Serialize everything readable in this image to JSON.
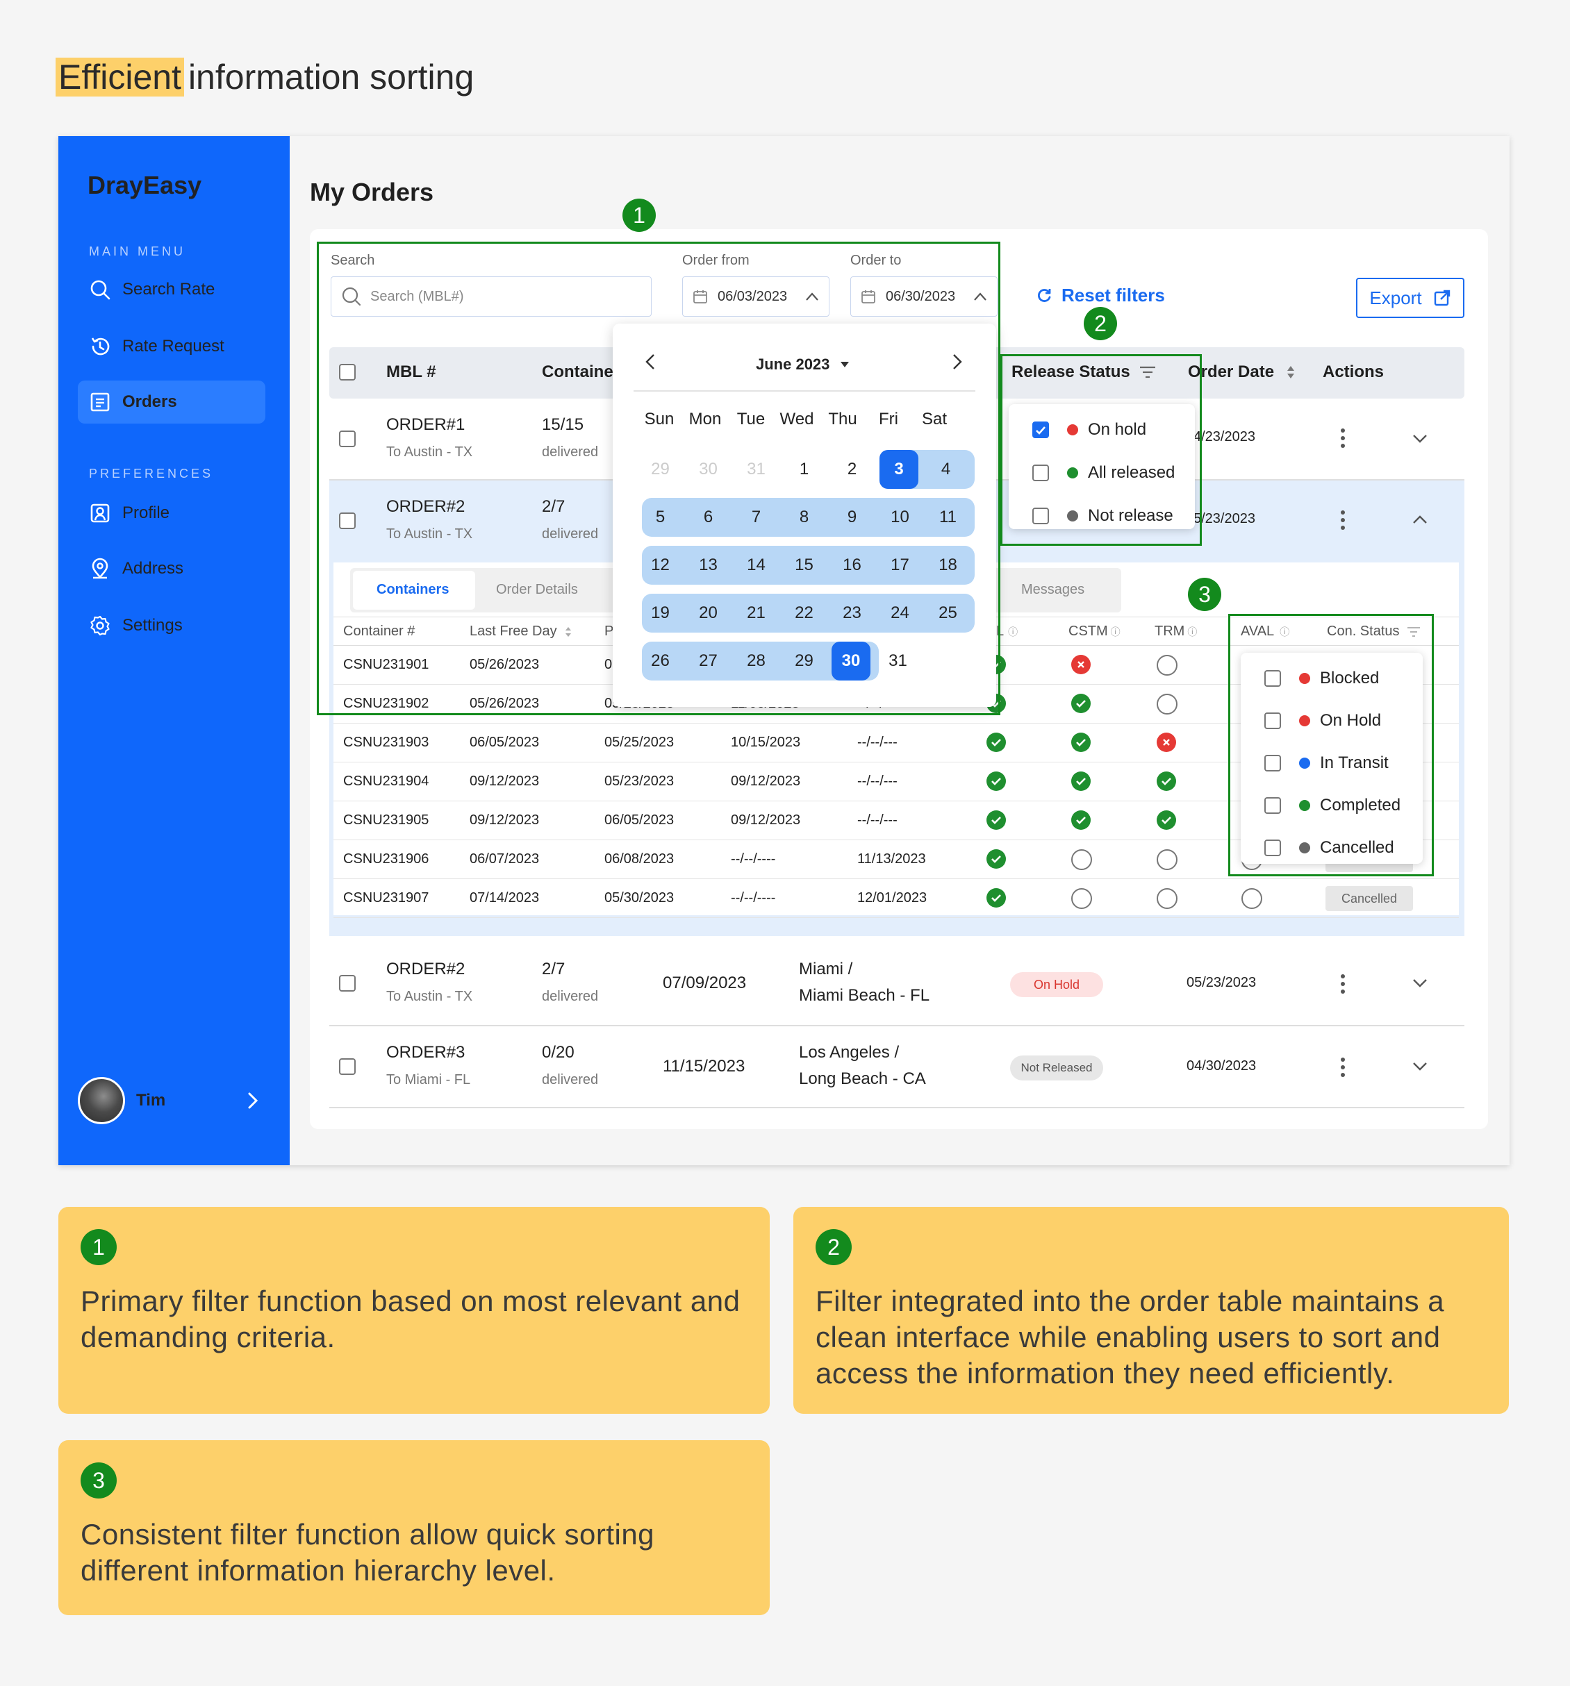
{
  "heading": {
    "highlight": "Efficient",
    "rest": "information sorting"
  },
  "sidebar": {
    "logo": "DrayEasy",
    "main_menu_label": "MAIN MENU",
    "preferences_label": "PREFERENCES",
    "items": [
      {
        "label": "Search Rate",
        "icon": "search-icon"
      },
      {
        "label": "Rate Request",
        "icon": "history-icon"
      },
      {
        "label": "Orders",
        "icon": "orders-icon",
        "active": true
      },
      {
        "label": "Profile",
        "icon": "profile-icon"
      },
      {
        "label": "Address",
        "icon": "location-icon"
      },
      {
        "label": "Settings",
        "icon": "gear-icon"
      }
    ],
    "user": {
      "name": "Tim"
    }
  },
  "page_title": "My Orders",
  "filters": {
    "search_label": "Search",
    "search_placeholder": "Search (MBL#)",
    "order_from_label": "Order from",
    "order_from_value": "06/03/2023",
    "order_to_label": "Order to",
    "order_to_value": "06/30/2023",
    "reset_label": "Reset filters",
    "export_label": "Export"
  },
  "table": {
    "headers": {
      "mbl": "MBL #",
      "container": "Containe",
      "release": "Release Status",
      "order_date": "Order Date",
      "actions": "Actions"
    },
    "rows": [
      {
        "order": "ORDER#1",
        "route": "To Austin - TX",
        "count": "15/15",
        "count_sub": "delivered",
        "order_date": "4/23/2023"
      },
      {
        "order": "ORDER#2",
        "route": "To Austin - TX",
        "count": "2/7",
        "count_sub": "delivered",
        "order_date": "5/23/2023"
      },
      {
        "order": "ORDER#2",
        "route": "To Austin - TX",
        "count": "2/7",
        "count_sub": "delivered",
        "eta": "07/09/2023",
        "dest1": "Miami /",
        "dest2": "Miami Beach - FL",
        "status": "On Hold",
        "order_date": "05/23/2023"
      },
      {
        "order": "ORDER#3",
        "route": "To Miami - FL",
        "count": "0/20",
        "count_sub": "delivered",
        "eta": "11/15/2023",
        "dest1": "Los Angeles /",
        "dest2": "Long Beach - CA",
        "status": "Not Released",
        "order_date": "04/30/2023"
      }
    ]
  },
  "subtabs": [
    "Containers",
    "Order Details",
    "Messages"
  ],
  "subtable": {
    "headers": {
      "container": "Container #",
      "lfd": "Last Free Day",
      "p": "P",
      "l": "L",
      "cstm": "CSTM",
      "trm": "TRM",
      "aval": "AVAL",
      "con_status": "Con. Status"
    },
    "rows": [
      {
        "c": "CSNU231901",
        "lfd": "05/26/2023",
        "d2": "0",
        "d3": "",
        "d4": "",
        "cstm": "bad",
        "trm": "empty",
        "aval": "empty"
      },
      {
        "c": "CSNU231902",
        "lfd": "05/26/2023",
        "d2": "05/23/2023",
        "d3": "11/08/2023",
        "d4": "--/--/----",
        "cstm": "ok",
        "trm": "empty",
        "aval": "empty"
      },
      {
        "c": "CSNU231903",
        "lfd": "06/05/2023",
        "d2": "05/25/2023",
        "d3": "10/15/2023",
        "d4": "--/--/---",
        "cstm": "ok",
        "trm": "bad",
        "aval": "empty"
      },
      {
        "c": "CSNU231904",
        "lfd": "09/12/2023",
        "d2": "05/23/2023",
        "d3": "09/12/2023",
        "d4": "--/--/---",
        "cstm": "ok",
        "trm": "ok",
        "aval": "empty"
      },
      {
        "c": "CSNU231905",
        "lfd": "09/12/2023",
        "d2": "06/05/2023",
        "d3": "09/12/2023",
        "d4": "--/--/---",
        "cstm": "ok",
        "trm": "ok",
        "aval": "empty"
      },
      {
        "c": "CSNU231906",
        "lfd": "06/07/2023",
        "d2": "06/08/2023",
        "d3": "--/--/----",
        "d4": "11/13/2023",
        "cstm": "empty",
        "trm": "empty",
        "aval": "empty",
        "status": "Cancelled"
      },
      {
        "c": "CSNU231907",
        "lfd": "07/14/2023",
        "d2": "05/30/2023",
        "d3": "--/--/----",
        "d4": "12/01/2023",
        "cstm": "empty",
        "trm": "empty",
        "aval": "empty",
        "status": "Cancelled"
      }
    ]
  },
  "calendar": {
    "month_label": "June 2023",
    "weekdays": [
      "Sun",
      "Mon",
      "Tue",
      "Wed",
      "Thu",
      "Fri",
      "Sat"
    ],
    "weeks": [
      [
        "29",
        "30",
        "31",
        "1",
        "2",
        "3",
        "4"
      ],
      [
        "5",
        "6",
        "7",
        "8",
        "9",
        "10",
        "11"
      ],
      [
        "12",
        "13",
        "14",
        "15",
        "16",
        "17",
        "18"
      ],
      [
        "19",
        "20",
        "21",
        "22",
        "23",
        "24",
        "25"
      ],
      [
        "26",
        "27",
        "28",
        "29",
        "30",
        "31"
      ]
    ],
    "range_start": "3",
    "range_end": "30"
  },
  "release_filter": [
    {
      "label": "On hold",
      "color": "#e53935",
      "checked": true
    },
    {
      "label": "All released",
      "color": "#1f8f2f",
      "checked": false
    },
    {
      "label": "Not release",
      "color": "#666666",
      "checked": false
    }
  ],
  "con_status_filter": [
    {
      "label": "Blocked",
      "color": "#e53935"
    },
    {
      "label": "On Hold",
      "color": "#e53935"
    },
    {
      "label": "In Transit",
      "color": "#1a6bf0"
    },
    {
      "label": "Completed",
      "color": "#1f8f2f"
    },
    {
      "label": "Cancelled",
      "color": "#666666"
    }
  ],
  "annotations": [
    "1",
    "2",
    "3"
  ],
  "notes": [
    {
      "num": "1",
      "text": "Primary filter function based on most relevant and demanding criteria."
    },
    {
      "num": "2",
      "text": "Filter integrated into the order table maintains a clean interface while enabling users to sort and access the information they need efficiently."
    },
    {
      "num": "3",
      "text": "Consistent filter function allow quick sorting different information hierarchy level."
    }
  ],
  "colors": {
    "sidebar": "#0f67fb",
    "accent": "#1a6bf0",
    "annotation": "#138a1d",
    "note_bg": "#fdd06a"
  }
}
